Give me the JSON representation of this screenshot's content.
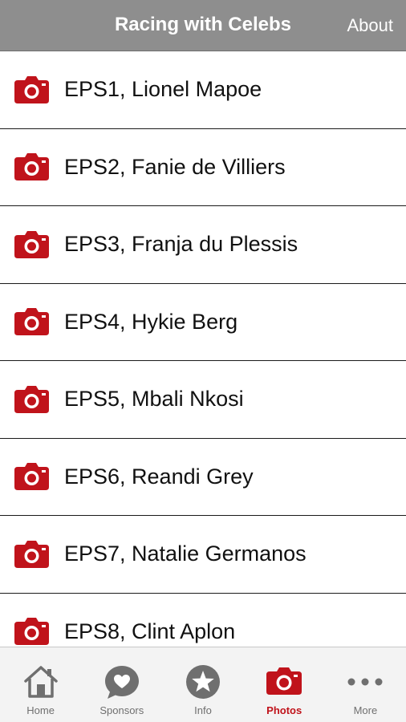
{
  "header": {
    "title": "Racing with Celebs",
    "about_label": "About"
  },
  "colors": {
    "accent": "#c0131b",
    "navbar": "#8e8e8e",
    "tab_icon": "#6f6f6f"
  },
  "episodes": [
    {
      "label": "EPS1, Lionel Mapoe",
      "icon": "camera-icon"
    },
    {
      "label": "EPS2, Fanie de Villiers",
      "icon": "camera-icon"
    },
    {
      "label": "EPS3, Franja du Plessis",
      "icon": "camera-icon"
    },
    {
      "label": "EPS4, Hykie Berg",
      "icon": "camera-icon"
    },
    {
      "label": "EPS5, Mbali Nkosi",
      "icon": "camera-icon"
    },
    {
      "label": "EPS6, Reandi Grey",
      "icon": "camera-icon"
    },
    {
      "label": "EPS7, Natalie Germanos",
      "icon": "camera-icon"
    },
    {
      "label": "EPS8, Clint Aplon",
      "icon": "camera-icon"
    }
  ],
  "tabs": [
    {
      "label": "Home",
      "icon": "home-icon",
      "active": false
    },
    {
      "label": "Sponsors",
      "icon": "heart-bubble-icon",
      "active": false
    },
    {
      "label": "Info",
      "icon": "star-icon",
      "active": false
    },
    {
      "label": "Photos",
      "icon": "camera-icon",
      "active": true
    },
    {
      "label": "More",
      "icon": "more-dots-icon",
      "active": false
    }
  ]
}
